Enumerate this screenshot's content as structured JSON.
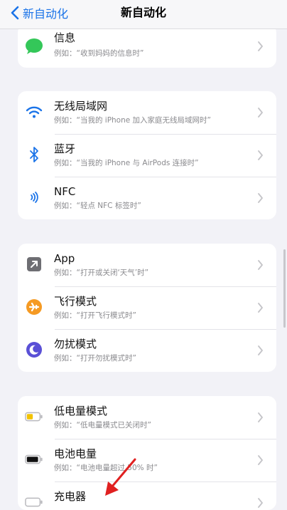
{
  "nav": {
    "back_label": "新自动化",
    "title": "新自动化"
  },
  "groups": [
    {
      "rows": [
        {
          "label": "信息",
          "sub": "例如：“收到妈妈的信息时”",
          "icon": "message-icon"
        }
      ]
    },
    {
      "rows": [
        {
          "label": "无线局域网",
          "sub": "例如：“当我的 iPhone 加入家庭无线局域网时”",
          "icon": "wifi-icon"
        },
        {
          "label": "蓝牙",
          "sub": "例如：“当我的 iPhone 与 AirPods 连接时”",
          "icon": "bluetooth-icon"
        },
        {
          "label": "NFC",
          "sub": "例如：“轻点 NFC 标签时”",
          "icon": "nfc-icon"
        }
      ]
    },
    {
      "rows": [
        {
          "label": "App",
          "sub": "例如：“打开或关闭‘天气’时”",
          "icon": "app-icon"
        },
        {
          "label": "飞行模式",
          "sub": "例如：“打开飞行模式时”",
          "icon": "airplane-icon"
        },
        {
          "label": "勿扰模式",
          "sub": "例如：“打开勿扰模式时”",
          "icon": "moon-icon"
        }
      ]
    },
    {
      "rows": [
        {
          "label": "低电量模式",
          "sub": "例如：“低电量模式已关闭时”",
          "icon": "low-battery-icon"
        },
        {
          "label": "电池电量",
          "sub": "例如：“电池电量超过 50% 时”",
          "icon": "battery-icon"
        },
        {
          "label": "充电器",
          "sub": "",
          "icon": "charger-icon"
        }
      ]
    }
  ],
  "colors": {
    "accent": "#1a73e8",
    "message": "#34c759",
    "airplane": "#f59a23",
    "moon": "#5a50d6",
    "low_battery": "#f2c200",
    "annotation": "#e02020"
  }
}
